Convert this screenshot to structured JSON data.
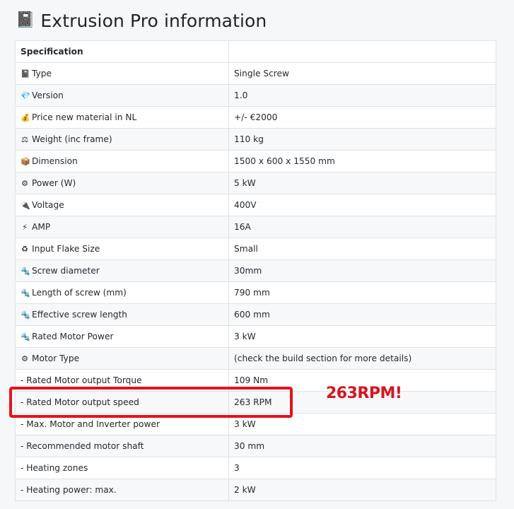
{
  "header": {
    "title_icon": "📓",
    "title": "Extrusion Pro information"
  },
  "table": {
    "header": {
      "col1": "Specification",
      "col2": ""
    },
    "rows": [
      {
        "icon": "📓",
        "icon_name": "notebook-icon",
        "label": "Type",
        "value": "Single Screw"
      },
      {
        "icon": "💎",
        "icon_name": "gem-icon",
        "label": "Version",
        "value": "1.0"
      },
      {
        "icon": "💰",
        "icon_name": "money-bag-icon",
        "label": "Price new material in NL",
        "value": "+/- €2000"
      },
      {
        "icon": "⚖",
        "icon_name": "scale-icon",
        "label": "Weight (inc frame)",
        "value": "110 kg"
      },
      {
        "icon": "📦",
        "icon_name": "package-icon",
        "label": "Dimension",
        "value": "1500 x 600 x 1550 mm"
      },
      {
        "icon": "⚙",
        "icon_name": "gear-icon",
        "label": "Power (W)",
        "value": "5 kW"
      },
      {
        "icon": "🔌",
        "icon_name": "plug-icon",
        "label": "Voltage",
        "value": "400V"
      },
      {
        "icon": "⚡",
        "icon_name": "lightning-icon",
        "label": "AMP",
        "value": "16A"
      },
      {
        "icon": "♻",
        "icon_name": "recycle-icon",
        "label": "Input Flake Size",
        "value": "Small"
      },
      {
        "icon": "🔩",
        "icon_name": "wrench-icon",
        "label": "Screw diameter",
        "value": "30mm"
      },
      {
        "icon": "🔩",
        "icon_name": "wrench-icon",
        "label": "Length of screw (mm)",
        "value": "790 mm"
      },
      {
        "icon": "🔩",
        "icon_name": "wrench-icon",
        "label": "Effective screw length",
        "value": "600 mm"
      },
      {
        "icon": "🔩",
        "icon_name": "wrench-icon",
        "label": "Rated Motor Power",
        "value": "3 kW"
      },
      {
        "icon": "⚙",
        "icon_name": "gear-icon",
        "label": "Motor Type",
        "value": "(check the build section for more details)"
      },
      {
        "icon": "",
        "icon_name": "",
        "label": "- Rated Motor output Torque",
        "value": "109 Nm"
      },
      {
        "icon": "",
        "icon_name": "",
        "label": "- Rated Motor output speed",
        "value": "263 RPM"
      },
      {
        "icon": "",
        "icon_name": "",
        "label": "- Max. Motor and Inverter power",
        "value": "3 kW"
      },
      {
        "icon": "",
        "icon_name": "",
        "label": "- Recommended motor shaft",
        "value": "30 mm"
      },
      {
        "icon": "",
        "icon_name": "",
        "label": "- Heating zones",
        "value": "3"
      },
      {
        "icon": "",
        "icon_name": "",
        "label": "- Heating power: max.",
        "value": "2 kW"
      }
    ]
  },
  "annotation": {
    "text": "263RPM!",
    "color": "#d8141d"
  }
}
